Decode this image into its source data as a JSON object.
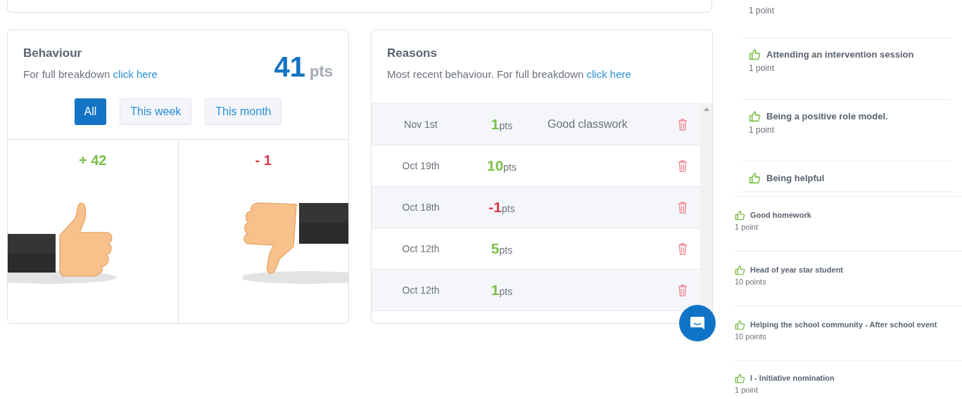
{
  "behaviour": {
    "title": "Behaviour",
    "subtitle": "For full breakdown",
    "link": "click here",
    "total": "41",
    "total_unit": "pts",
    "filters": [
      {
        "label": "All",
        "selected": true
      },
      {
        "label": "This week",
        "selected": false
      },
      {
        "label": "This month",
        "selected": false
      }
    ],
    "panels": [
      {
        "kind": "positive",
        "count": "+ 42"
      },
      {
        "kind": "negative",
        "count": "- 1"
      }
    ]
  },
  "reasons": {
    "title": "Reasons",
    "subtitle": "Most recent behaviour. For full breakdown",
    "link": "click here",
    "rows": [
      {
        "date": "Nov 1st",
        "points": "1",
        "unit": "pts",
        "kind": "positive",
        "reason": "Good classwork"
      },
      {
        "date": "Oct 19th",
        "points": "10",
        "unit": "pts",
        "kind": "positive"
      },
      {
        "date": "Oct 18th",
        "points": "-1",
        "unit": "pts",
        "kind": "negative"
      },
      {
        "date": "Oct 12th",
        "points": "5",
        "unit": "pts",
        "kind": "positive"
      },
      {
        "date": "Oct 12th",
        "points": "1",
        "unit": "pts",
        "kind": "positive"
      }
    ]
  },
  "reason_list_upper": [
    {
      "points": "1 point"
    },
    {
      "title": "Attending an intervention session",
      "points": "1 point"
    },
    {
      "title": "Being a positive role model.",
      "points": "1 point"
    },
    {
      "title": "Being helpful"
    }
  ],
  "reason_list_lower": [
    {
      "title": "Good homework",
      "points": "1 point"
    },
    {
      "title": "Head of year star student",
      "points": "10 points"
    },
    {
      "title": "Helping the school community - After school event",
      "points": "10 points"
    },
    {
      "title": "I - Initiative nomination",
      "points": "1 point"
    }
  ]
}
